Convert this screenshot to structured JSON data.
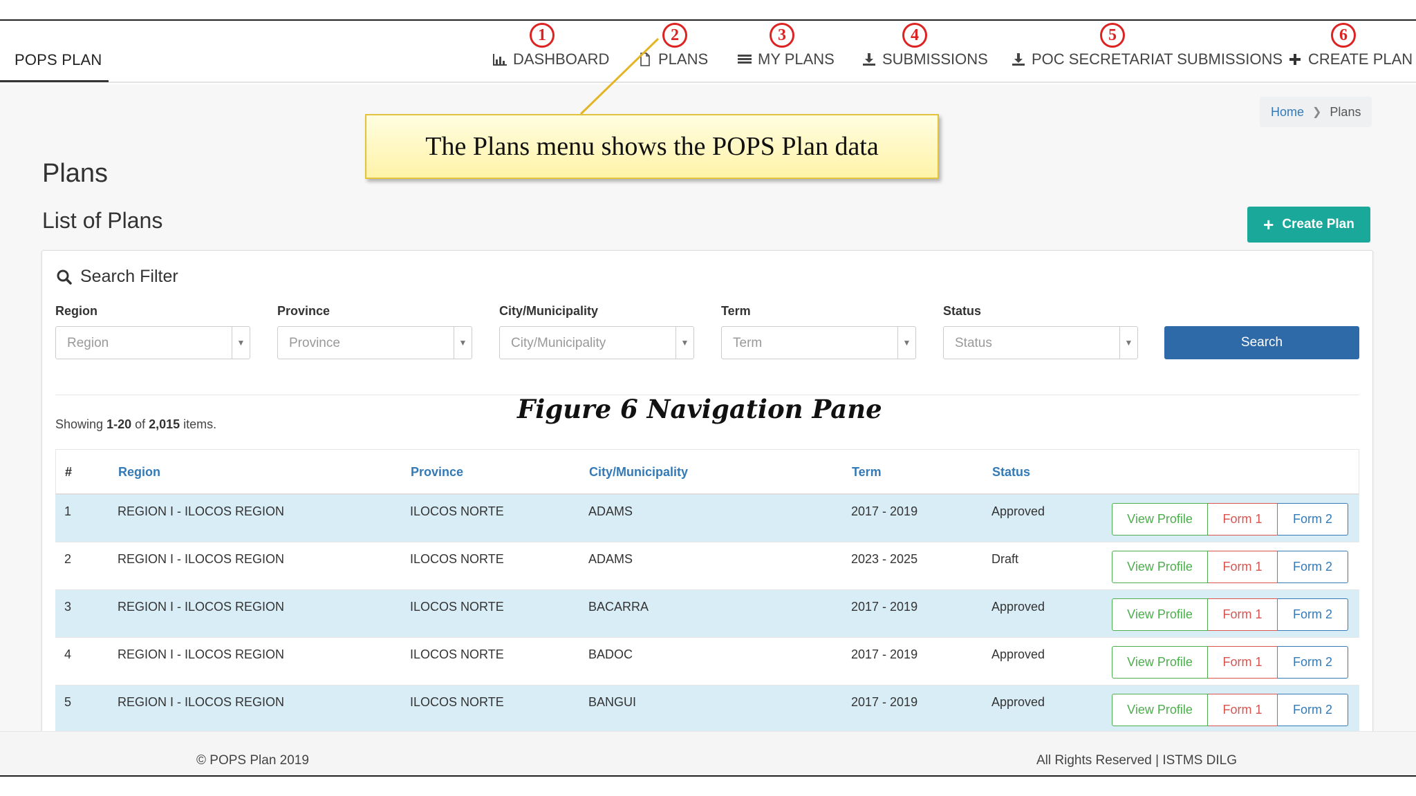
{
  "navbar": {
    "brand": "POPS PLAN",
    "items": [
      {
        "label": "DASHBOARD",
        "icon": "bar-chart-icon",
        "number": "1"
      },
      {
        "label": "PLANS",
        "icon": "document-icon",
        "number": "2"
      },
      {
        "label": "MY PLANS",
        "icon": "list-icon",
        "number": "3"
      },
      {
        "label": "SUBMISSIONS",
        "icon": "download-icon",
        "number": "4"
      },
      {
        "label": "POC SECRETARIAT SUBMISSIONS",
        "icon": "download-icon",
        "number": "5"
      },
      {
        "label": "CREATE PLAN",
        "icon": "plus-icon",
        "number": "6"
      }
    ]
  },
  "breadcrumb": {
    "home": "Home",
    "current": "Plans"
  },
  "page": {
    "title": "Plans",
    "subtitle": "List of Plans",
    "create_label": "Create Plan"
  },
  "filter": {
    "title": "Search Filter",
    "fields": [
      {
        "label": "Region",
        "placeholder": "Region"
      },
      {
        "label": "Province",
        "placeholder": "Province"
      },
      {
        "label": "City/Municipality",
        "placeholder": "City/Municipality"
      },
      {
        "label": "Term",
        "placeholder": "Term"
      },
      {
        "label": "Status",
        "placeholder": "Status"
      }
    ],
    "search_label": "Search"
  },
  "summary": {
    "prefix": "Showing ",
    "range": "1-20",
    "middle": " of ",
    "total": "2,015",
    "suffix": " items."
  },
  "table": {
    "headers": [
      "#",
      "Region",
      "Province",
      "City/Municipality",
      "Term",
      "Status"
    ],
    "rows": [
      {
        "num": "1",
        "region": "REGION I - ILOCOS REGION",
        "province": "ILOCOS NORTE",
        "city": "ADAMS",
        "term": "2017 - 2019",
        "status": "Approved"
      },
      {
        "num": "2",
        "region": "REGION I - ILOCOS REGION",
        "province": "ILOCOS NORTE",
        "city": "ADAMS",
        "term": "2023 - 2025",
        "status": "Draft"
      },
      {
        "num": "3",
        "region": "REGION I - ILOCOS REGION",
        "province": "ILOCOS NORTE",
        "city": "BACARRA",
        "term": "2017 - 2019",
        "status": "Approved"
      },
      {
        "num": "4",
        "region": "REGION I - ILOCOS REGION",
        "province": "ILOCOS NORTE",
        "city": "BADOC",
        "term": "2017 - 2019",
        "status": "Approved"
      },
      {
        "num": "5",
        "region": "REGION I - ILOCOS REGION",
        "province": "ILOCOS NORTE",
        "city": "BANGUI",
        "term": "2017 - 2019",
        "status": "Approved"
      }
    ],
    "actions": {
      "view_profile": "View Profile",
      "form1": "Form 1",
      "form2": "Form 2"
    }
  },
  "footer": {
    "left": "© POPS Plan 2019",
    "right": "All Rights Reserved | ISTMS DILG"
  },
  "annotations": {
    "callout": "The Plans menu shows the POPS Plan data",
    "figure_caption": "Figure 6 Navigation Pane"
  },
  "colors": {
    "teal": "#1aa89b",
    "primary": "#2e6aa8",
    "link": "#337ab7",
    "success": "#4cae4c",
    "danger": "#d9534f",
    "row_highlight": "#d9edf7",
    "annotation_red": "#dd2222",
    "callout_yellow": "#fff3a8"
  }
}
